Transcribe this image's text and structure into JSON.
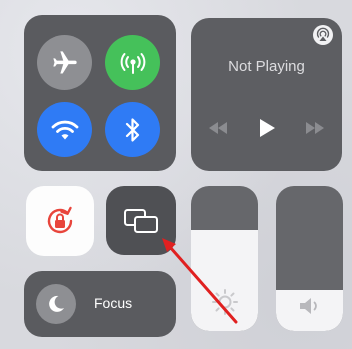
{
  "connectivity": {
    "airplane": {
      "icon": "airplane-icon",
      "state": "off"
    },
    "cellular": {
      "icon": "cellular-antenna-icon",
      "state": "on",
      "color": "#45c15a"
    },
    "wifi": {
      "icon": "wifi-icon",
      "state": "on",
      "color": "#2f7bf5"
    },
    "bluetooth": {
      "icon": "bluetooth-icon",
      "state": "on",
      "color": "#2f7bf5"
    }
  },
  "media": {
    "status": "Not Playing",
    "airplay_icon": "airplay-icon",
    "controls": [
      "rewind-icon",
      "play-icon",
      "fast-forward-icon"
    ]
  },
  "rotation_lock": {
    "icon": "rotation-lock-icon",
    "state": "on",
    "color": "#e8453c"
  },
  "screen_mirroring": {
    "icon": "screen-mirroring-icon"
  },
  "focus": {
    "label": "Focus",
    "icon": "moon-icon"
  },
  "brightness": {
    "level": 0.7,
    "icon": "sun-icon"
  },
  "volume": {
    "level": 0.28,
    "icon": "speaker-icon"
  },
  "annotation": {
    "icon": "red-arrow-icon",
    "color": "#e02020",
    "points_to": "screen-mirroring-button"
  }
}
